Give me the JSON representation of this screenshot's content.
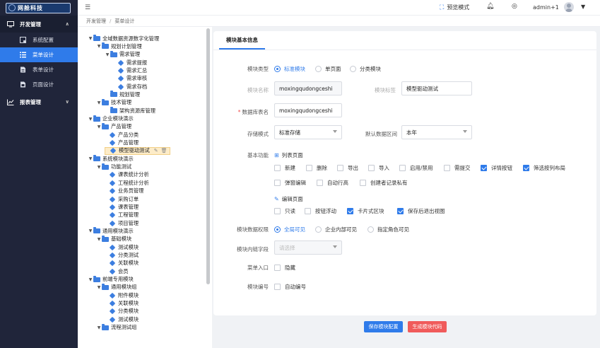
{
  "app": {
    "logo_text": "网舱科技"
  },
  "sidebar": {
    "groups": [
      {
        "label": "开发管理",
        "expanded": true
      },
      {
        "label": "报表管理",
        "expanded": false
      }
    ],
    "items": [
      {
        "label": "系统配置",
        "active": false
      },
      {
        "label": "菜单设计",
        "active": true
      },
      {
        "label": "表单设计",
        "active": false
      },
      {
        "label": "页面设计",
        "active": false
      }
    ]
  },
  "header": {
    "preview_label": "预览模式",
    "username": "admin+1"
  },
  "breadcrumb": [
    "开发管理",
    "菜单设计"
  ],
  "tree": [
    {
      "label": "全域数据资源数字化管理",
      "type": "folder",
      "toggle": "▼"
    },
    {
      "label": "规划计划管理",
      "type": "folder",
      "toggle": "▼"
    },
    {
      "label": "需求管理",
      "type": "folder",
      "toggle": "▼"
    },
    {
      "label": "需求提报",
      "type": "leaf",
      "toggle": ""
    },
    {
      "label": "需求汇总",
      "type": "leaf",
      "toggle": ""
    },
    {
      "label": "需求审核",
      "type": "leaf",
      "toggle": ""
    },
    {
      "label": "需求存档",
      "type": "leaf",
      "toggle": ""
    },
    {
      "label": "规划管理",
      "type": "folder",
      "toggle": ""
    },
    {
      "label": "技术管理",
      "type": "folder",
      "toggle": "▼"
    },
    {
      "label": "架构资源库管理",
      "type": "folder",
      "toggle": ""
    },
    {
      "label": "企业模块演示",
      "type": "folder",
      "toggle": "▼"
    },
    {
      "label": "产品管理",
      "type": "folder",
      "toggle": "▼"
    },
    {
      "label": "产品分类",
      "type": "leaf",
      "toggle": ""
    },
    {
      "label": "产品管理",
      "type": "leaf",
      "toggle": ""
    },
    {
      "label": "模型驱动测试",
      "type": "leaf",
      "toggle": "",
      "selected": true
    },
    {
      "label": "系统模块演示",
      "type": "folder",
      "toggle": "▼"
    },
    {
      "label": "功能测试",
      "type": "folder",
      "toggle": "▼"
    },
    {
      "label": "课表统计分析",
      "type": "leaf",
      "toggle": ""
    },
    {
      "label": "工程统计分析",
      "type": "leaf",
      "toggle": ""
    },
    {
      "label": "业务员管理",
      "type": "leaf",
      "toggle": ""
    },
    {
      "label": "采购订单",
      "type": "leaf",
      "toggle": ""
    },
    {
      "label": "课表管理",
      "type": "leaf",
      "toggle": ""
    },
    {
      "label": "工程管理",
      "type": "leaf",
      "toggle": ""
    },
    {
      "label": "项目管理",
      "type": "leaf",
      "toggle": ""
    },
    {
      "label": "通用模块演示",
      "type": "folder",
      "toggle": "▼"
    },
    {
      "label": "基础模块",
      "type": "folder",
      "toggle": "▼"
    },
    {
      "label": "测试模块",
      "type": "leaf",
      "toggle": ""
    },
    {
      "label": "分类测试",
      "type": "leaf",
      "toggle": ""
    },
    {
      "label": "关联模块",
      "type": "leaf",
      "toggle": ""
    },
    {
      "label": "会员",
      "type": "leaf",
      "toggle": ""
    },
    {
      "label": "前端专用模块",
      "type": "folder",
      "toggle": "▼"
    },
    {
      "label": "通用模块组",
      "type": "folder",
      "toggle": "▼"
    },
    {
      "label": "附件模块",
      "type": "leaf",
      "toggle": ""
    },
    {
      "label": "关联模块",
      "type": "leaf",
      "toggle": ""
    },
    {
      "label": "分类模块",
      "type": "leaf",
      "toggle": ""
    },
    {
      "label": "测试模块",
      "type": "leaf",
      "toggle": ""
    },
    {
      "label": "流程测试组",
      "type": "folder",
      "toggle": "▼"
    }
  ],
  "form": {
    "tab_label": "模块基本信息",
    "module_type": {
      "label": "模块类型",
      "options": [
        "标准模块",
        "单页面",
        "分类模块"
      ],
      "selected": "标准模块"
    },
    "module_name": {
      "label": "模块名称",
      "value": "moxingqudongceshi"
    },
    "module_title": {
      "label": "模块标签",
      "value": "模型驱动测试"
    },
    "db_table": {
      "label": "数据库表名",
      "value": "moxingqudongceshi"
    },
    "storage_mode": {
      "label": "存储模式",
      "value": "标准存储"
    },
    "default_range": {
      "label": "默认数据区间",
      "value": "本年"
    },
    "basic_functions": {
      "label": "基本功能",
      "list_page_title": "列表页面",
      "list_options": [
        {
          "label": "新建",
          "checked": false
        },
        {
          "label": "删除",
          "checked": false
        },
        {
          "label": "导出",
          "checked": false
        },
        {
          "label": "导入",
          "checked": false
        },
        {
          "label": "启用/禁用",
          "checked": false
        },
        {
          "label": "需提交",
          "checked": false
        },
        {
          "label": "详情按钮",
          "checked": true
        },
        {
          "label": "筛选按列布局",
          "checked": true
        },
        {
          "label": "弹窗编辑",
          "checked": false
        },
        {
          "label": "自动行高",
          "checked": false
        },
        {
          "label": "创建者记录私有",
          "checked": false
        }
      ],
      "edit_page_title": "编辑页面",
      "edit_options": [
        {
          "label": "只读",
          "checked": false
        },
        {
          "label": "按钮浮动",
          "checked": false
        },
        {
          "label": "卡片式区块",
          "checked": true
        },
        {
          "label": "保存后退出视图",
          "checked": true
        }
      ]
    },
    "data_permission": {
      "label": "模块数据权限",
      "options": [
        "全局可见",
        "企业内部可见",
        "指定角色可见"
      ],
      "selected": "全局可见"
    },
    "link_field": {
      "label": "模块内链字段",
      "placeholder": "请选择"
    },
    "menu_entry": {
      "label": "菜单入口",
      "option": "隐藏",
      "checked": false
    },
    "module_code": {
      "label": "模块编号",
      "option": "自动编号",
      "checked": false
    }
  },
  "actions": {
    "save": "保存模块配置",
    "generate": "生成模块代码"
  }
}
